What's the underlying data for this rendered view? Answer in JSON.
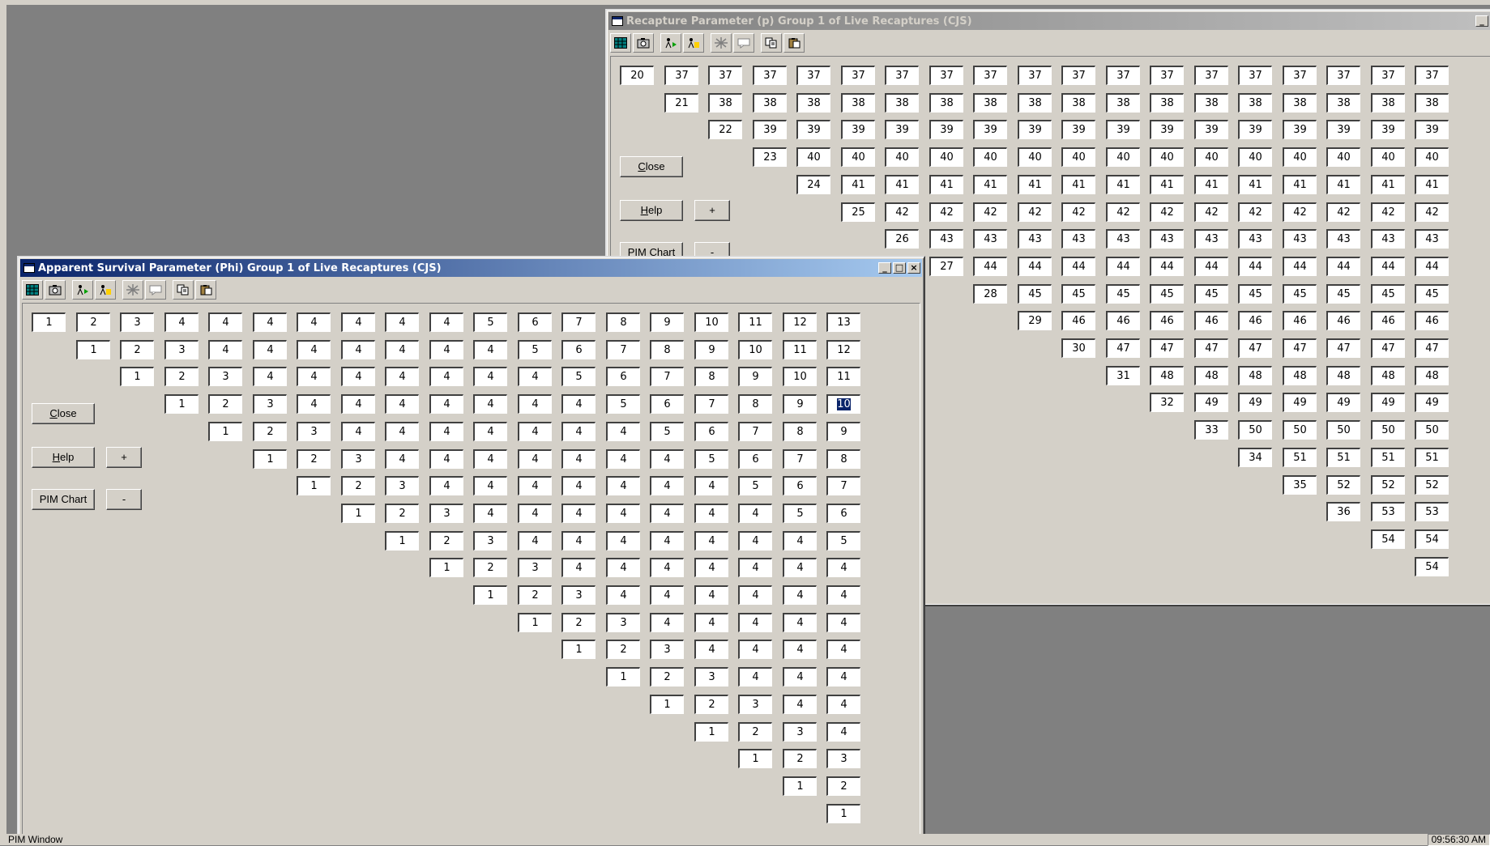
{
  "windows": {
    "recapture": {
      "title": "Recapture Parameter (p) Group 1 of Live Recaptures (CJS)",
      "buttons": {
        "close": "Close",
        "help": "Help",
        "plus": "+",
        "pim_chart": "PIM Chart",
        "minus": "-"
      },
      "rows": [
        [
          "20",
          "37",
          "37",
          "37",
          "37",
          "37",
          "37",
          "37",
          "37",
          "37",
          "37",
          "37",
          "37",
          "37",
          "37",
          "37",
          "37",
          "37",
          "37"
        ],
        [
          "21",
          "38",
          "38",
          "38",
          "38",
          "38",
          "38",
          "38",
          "38",
          "38",
          "38",
          "38",
          "38",
          "38",
          "38",
          "38",
          "38",
          "38"
        ],
        [
          "22",
          "39",
          "39",
          "39",
          "39",
          "39",
          "39",
          "39",
          "39",
          "39",
          "39",
          "39",
          "39",
          "39",
          "39",
          "39",
          "39"
        ],
        [
          "23",
          "40",
          "40",
          "40",
          "40",
          "40",
          "40",
          "40",
          "40",
          "40",
          "40",
          "40",
          "40",
          "40",
          "40",
          "40"
        ],
        [
          "24",
          "41",
          "41",
          "41",
          "41",
          "41",
          "41",
          "41",
          "41",
          "41",
          "41",
          "41",
          "41",
          "41",
          "41"
        ],
        [
          "25",
          "42",
          "42",
          "42",
          "42",
          "42",
          "42",
          "42",
          "42",
          "42",
          "42",
          "42",
          "42",
          "42"
        ],
        [
          "26",
          "43",
          "43",
          "43",
          "43",
          "43",
          "43",
          "43",
          "43",
          "43",
          "43",
          "43",
          "43"
        ],
        [
          "27",
          "44",
          "44",
          "44",
          "44",
          "44",
          "44",
          "44",
          "44",
          "44",
          "44",
          "44"
        ],
        [
          "28",
          "45",
          "45",
          "45",
          "45",
          "45",
          "45",
          "45",
          "45",
          "45",
          "45"
        ],
        [
          "29",
          "46",
          "46",
          "46",
          "46",
          "46",
          "46",
          "46",
          "46",
          "46"
        ],
        [
          "30",
          "47",
          "47",
          "47",
          "47",
          "47",
          "47",
          "47",
          "47"
        ],
        [
          "31",
          "48",
          "48",
          "48",
          "48",
          "48",
          "48",
          "48"
        ],
        [
          "32",
          "49",
          "49",
          "49",
          "49",
          "49",
          "49"
        ],
        [
          "33",
          "50",
          "50",
          "50",
          "50",
          "50"
        ],
        [
          "34",
          "51",
          "51",
          "51",
          "51"
        ],
        [
          "35",
          "52",
          "52",
          "52"
        ],
        [
          "36",
          "53",
          "53"
        ],
        [
          "54",
          "54"
        ],
        [
          "54"
        ]
      ]
    },
    "survival": {
      "title": "Apparent Survival Parameter (Phi) Group 1 of Live Recaptures (CJS)",
      "buttons": {
        "close": "Close",
        "help": "Help",
        "plus": "+",
        "pim_chart": "PIM Chart",
        "minus": "-"
      },
      "selected_cell": [
        3,
        15
      ],
      "rows": [
        [
          "1",
          "2",
          "3",
          "4",
          "4",
          "4",
          "4",
          "4",
          "4",
          "4",
          "5",
          "6",
          "7",
          "8",
          "9",
          "10",
          "11",
          "12",
          "13"
        ],
        [
          "1",
          "2",
          "3",
          "4",
          "4",
          "4",
          "4",
          "4",
          "4",
          "4",
          "5",
          "6",
          "7",
          "8",
          "9",
          "10",
          "11",
          "12"
        ],
        [
          "1",
          "2",
          "3",
          "4",
          "4",
          "4",
          "4",
          "4",
          "4",
          "4",
          "5",
          "6",
          "7",
          "8",
          "9",
          "10",
          "11"
        ],
        [
          "1",
          "2",
          "3",
          "4",
          "4",
          "4",
          "4",
          "4",
          "4",
          "4",
          "5",
          "6",
          "7",
          "8",
          "9",
          "10"
        ],
        [
          "1",
          "2",
          "3",
          "4",
          "4",
          "4",
          "4",
          "4",
          "4",
          "4",
          "5",
          "6",
          "7",
          "8",
          "9"
        ],
        [
          "1",
          "2",
          "3",
          "4",
          "4",
          "4",
          "4",
          "4",
          "4",
          "4",
          "5",
          "6",
          "7",
          "8"
        ],
        [
          "1",
          "2",
          "3",
          "4",
          "4",
          "4",
          "4",
          "4",
          "4",
          "4",
          "5",
          "6",
          "7"
        ],
        [
          "1",
          "2",
          "3",
          "4",
          "4",
          "4",
          "4",
          "4",
          "4",
          "4",
          "5",
          "6"
        ],
        [
          "1",
          "2",
          "3",
          "4",
          "4",
          "4",
          "4",
          "4",
          "4",
          "4",
          "5"
        ],
        [
          "1",
          "2",
          "3",
          "4",
          "4",
          "4",
          "4",
          "4",
          "4",
          "4"
        ],
        [
          "1",
          "2",
          "3",
          "4",
          "4",
          "4",
          "4",
          "4",
          "4"
        ],
        [
          "1",
          "2",
          "3",
          "4",
          "4",
          "4",
          "4",
          "4"
        ],
        [
          "1",
          "2",
          "3",
          "4",
          "4",
          "4",
          "4"
        ],
        [
          "1",
          "2",
          "3",
          "4",
          "4",
          "4"
        ],
        [
          "1",
          "2",
          "3",
          "4",
          "4"
        ],
        [
          "1",
          "2",
          "3",
          "4"
        ],
        [
          "1",
          "2",
          "3"
        ],
        [
          "1",
          "2"
        ],
        [
          "1"
        ]
      ]
    }
  },
  "toolbar_icons": [
    "grid-icon",
    "camera-icon",
    "run-icon",
    "run-highlight-icon",
    "clear-icon",
    "comment-icon",
    "copy-icon",
    "paste-icon"
  ],
  "statusbar": {
    "left": "PIM Window",
    "right": "09:56:30 AM"
  }
}
